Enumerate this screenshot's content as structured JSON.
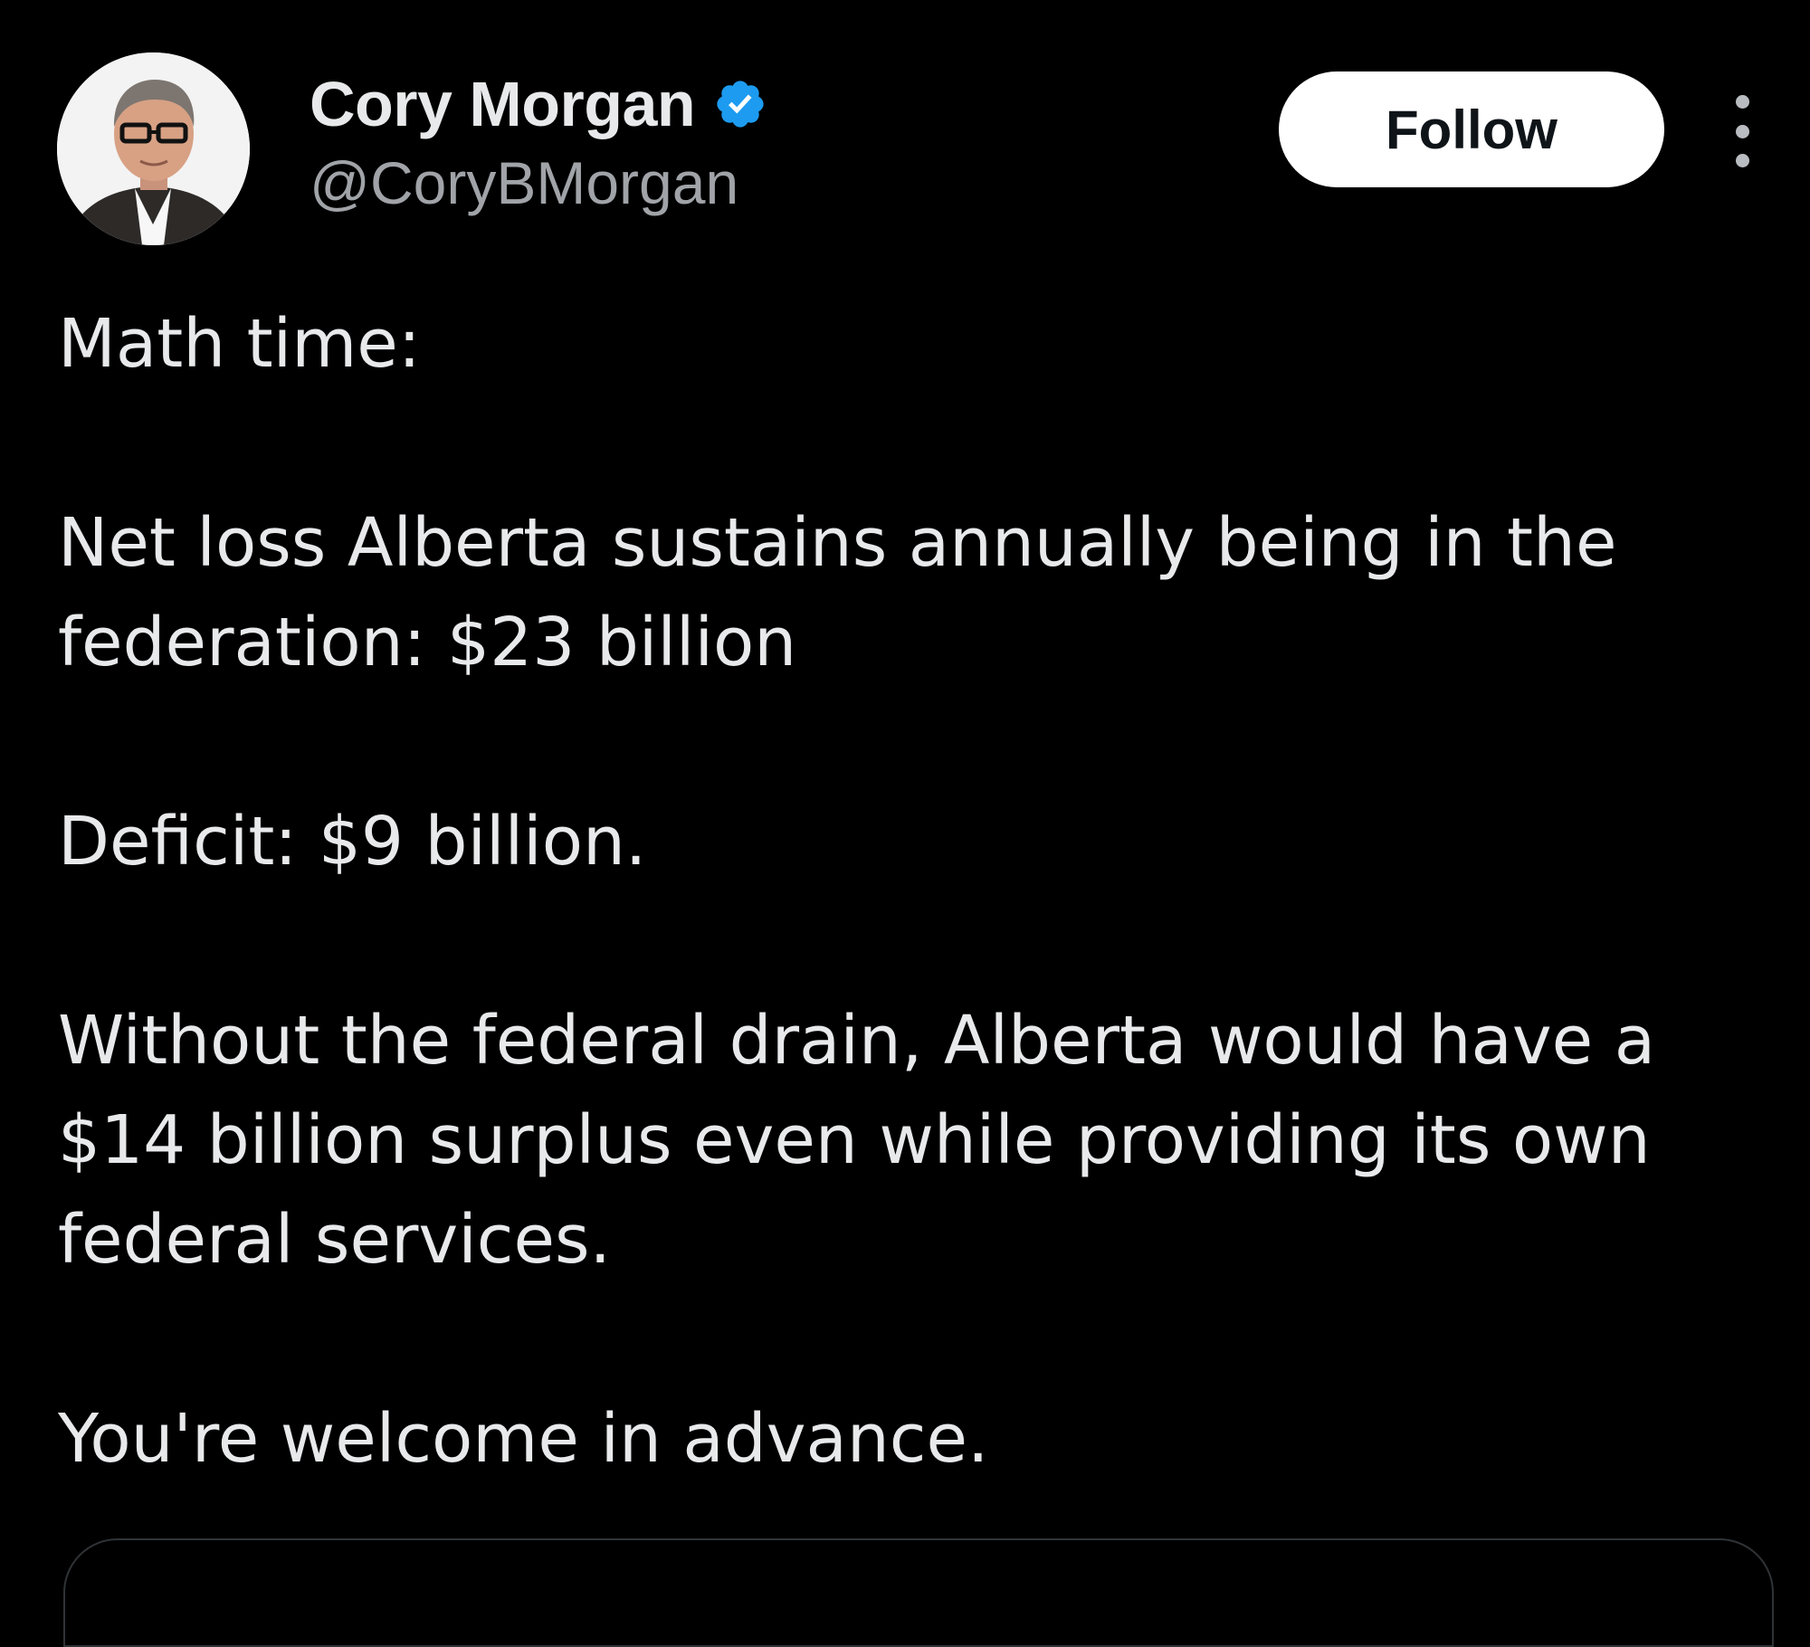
{
  "author": {
    "display_name": "Cory Morgan",
    "handle": "@CoryBMorgan",
    "verified": true,
    "avatar_icon": "profile-photo",
    "badge_icon": "verified-badge-icon"
  },
  "actions": {
    "follow_label": "Follow",
    "more_icon": "more-vertical-icon"
  },
  "tweet": {
    "paragraphs": [
      "Math time:",
      "Net loss Alberta sustains annually being in the federation: $23 billion",
      "Deficit: $9 billion.",
      "Without the federal drain, Alberta would have a $14 billion surplus even while providing its own federal services.",
      "You're welcome in advance."
    ]
  },
  "colors": {
    "background": "#000000",
    "text": "#e7e9ea",
    "secondary_text": "#a0a3a7",
    "verified_blue": "#1d9bf0",
    "follow_bg": "#ffffff"
  }
}
